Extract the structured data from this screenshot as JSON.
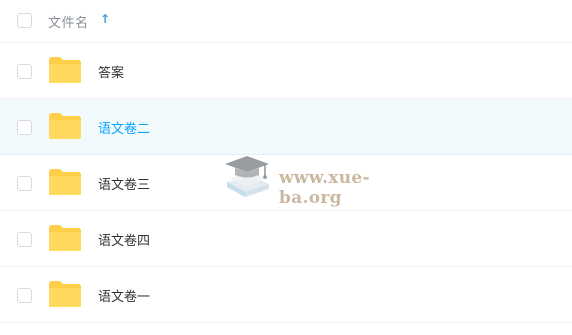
{
  "header": {
    "column_label": "文件名",
    "sort_icon": "sort-up-arrow-icon",
    "sort_glyph": "↑"
  },
  "files": [
    {
      "name": "答案",
      "type": "folder",
      "hovered": false
    },
    {
      "name": "语文卷二",
      "type": "folder",
      "hovered": true
    },
    {
      "name": "语文卷三",
      "type": "folder",
      "hovered": false
    },
    {
      "name": "语文卷四",
      "type": "folder",
      "hovered": false
    },
    {
      "name": "语文卷一",
      "type": "folder",
      "hovered": false
    }
  ],
  "watermark": {
    "text": "www.xue-ba.org",
    "icon": "graduation-cap-book-icon"
  },
  "colors": {
    "folder": "#ffcf4a",
    "accent": "#06a7ff",
    "hover_bg": "#f3fafe",
    "sort_arrow": "#3d9bd6"
  }
}
